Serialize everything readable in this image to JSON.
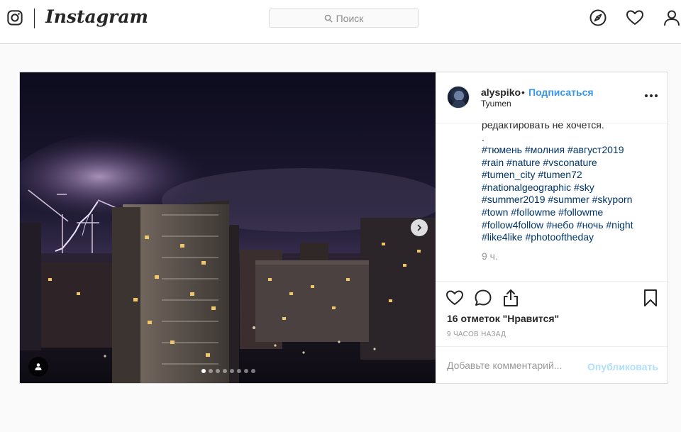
{
  "nav": {
    "wordmark": "Instagram",
    "search_placeholder": "Поиск",
    "icons": [
      "instagram-glyph-icon",
      "compass-icon",
      "heart-icon",
      "profile-icon"
    ]
  },
  "post": {
    "username": "alyspiko",
    "separator": "•",
    "follow_label": "Подписаться",
    "location": "Tyumen",
    "caption_text": "редактировать не хочется.\n.",
    "hashtag_lines": [
      [
        "#тюмень",
        "#молния",
        "#август2019"
      ],
      [
        "#rain",
        "#nature",
        "#vsconature"
      ],
      [
        "#tumen_city",
        "#tumen72"
      ],
      [
        "#nationalgeographic",
        "#sky"
      ],
      [
        "#summer2019",
        "#summer",
        "#skyporn"
      ],
      [
        "#town",
        "#followme",
        "#followme"
      ],
      [
        "#follow4follow",
        "#небо",
        "#ночь",
        "#night"
      ],
      [
        "#like4like",
        "#photooftheday"
      ]
    ],
    "caption_time": "9 ч.",
    "likes_text": "16 отметок \"Нравится\"",
    "timestamp": "9 ЧАСОВ НАЗАД",
    "comment_placeholder": "Добавьте комментарий...",
    "publish_label": "Опубликовать",
    "carousel": {
      "slides": 8,
      "active_index": 0
    },
    "colors": {
      "link": "#003569",
      "follow": "#3897f0",
      "publish_disabled": "#b2dffc",
      "muted": "#999999"
    }
  }
}
